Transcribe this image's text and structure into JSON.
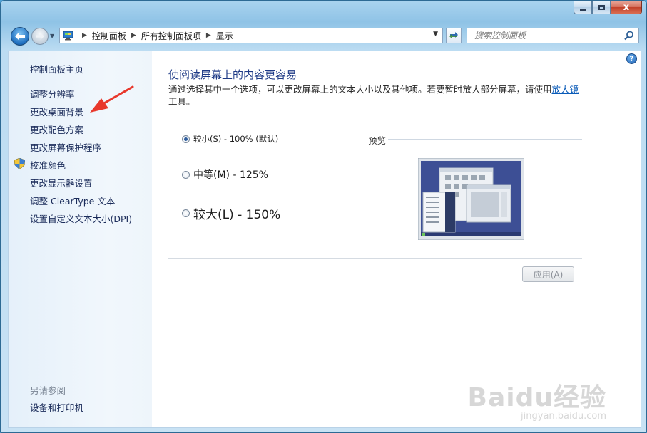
{
  "window": {
    "min_label": "",
    "max_label": "",
    "close_label": "x"
  },
  "address_bar": {
    "crumbs": [
      "控制面板",
      "所有控制面板项",
      "显示"
    ]
  },
  "search": {
    "placeholder": "搜索控制面板"
  },
  "left_pane": {
    "home": "控制面板主页",
    "links": [
      "调整分辨率",
      "更改桌面背景",
      "更改配色方案",
      "更改屏幕保护程序",
      "校准颜色",
      "更改显示器设置",
      "调整 ClearType 文本",
      "设置自定义文本大小(DPI)"
    ],
    "see_also_title": "另请参阅",
    "see_also_links": [
      "设备和打印机"
    ]
  },
  "main": {
    "heading": "使阅读屏幕上的内容更容易",
    "desc_before": "通过选择其中一个选项，可以更改屏幕上的文本大小以及其他项。若要暂时放大部分屏幕，请使用",
    "desc_link": "放大镜",
    "desc_after": "工具。",
    "options": [
      {
        "label": "较小(S) - 100% (默认)",
        "checked": true
      },
      {
        "label": "中等(M) - 125%",
        "checked": false
      },
      {
        "label": "较大(L) - 150%",
        "checked": false
      }
    ],
    "preview_label": "预览",
    "apply_label": "应用(A)"
  },
  "watermark": {
    "main": "Baidu经验",
    "sub": "jingyan.baidu.com"
  },
  "colors": {
    "accent_heading": "#1e3a86",
    "link": "#0a5bb8",
    "arrow": "#e8382c"
  }
}
